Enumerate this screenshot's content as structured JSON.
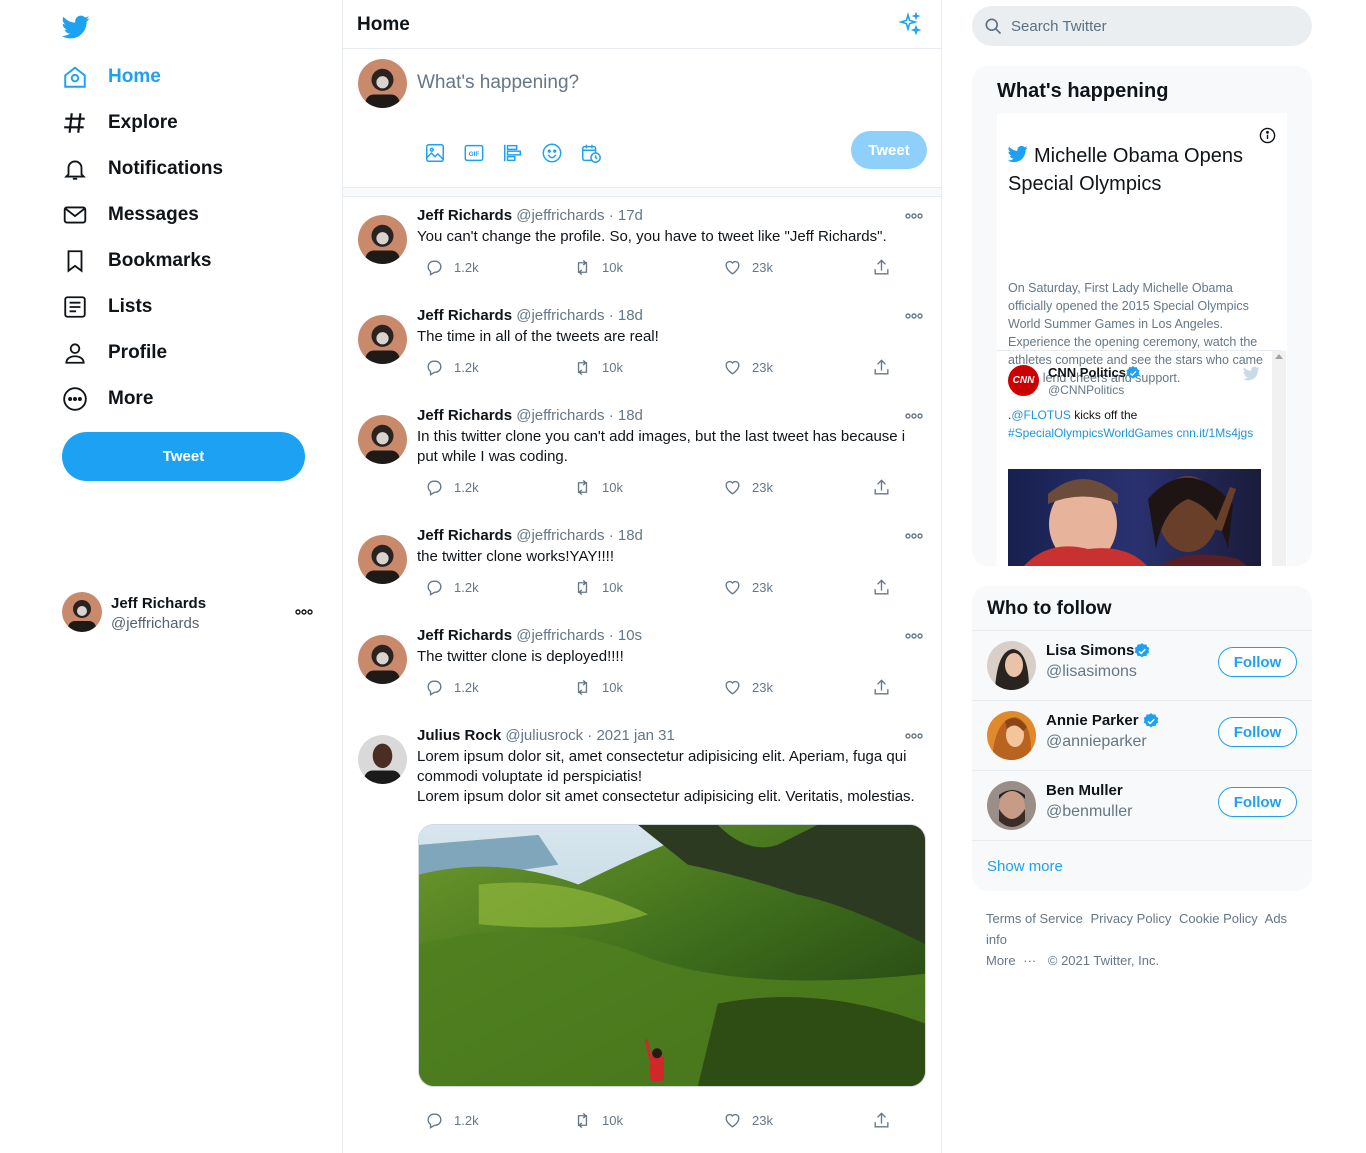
{
  "nav": {
    "items": [
      {
        "label": "Home",
        "icon": "home-icon",
        "active": true
      },
      {
        "label": "Explore",
        "icon": "hashtag-icon"
      },
      {
        "label": "Notifications",
        "icon": "bell-icon"
      },
      {
        "label": "Messages",
        "icon": "mail-icon"
      },
      {
        "label": "Bookmarks",
        "icon": "bookmark-icon"
      },
      {
        "label": "Lists",
        "icon": "list-icon"
      },
      {
        "label": "Profile",
        "icon": "profile-icon"
      },
      {
        "label": "More",
        "icon": "more-circle-icon"
      }
    ],
    "tweet_button": "Tweet"
  },
  "account": {
    "name": "Jeff Richards",
    "handle": "@jeffrichards"
  },
  "main": {
    "title": "Home",
    "composer": {
      "placeholder": "What's happening?",
      "tweet_button": "Tweet"
    }
  },
  "tweets": [
    {
      "name": "Jeff Richards",
      "handle": "@jeffrichards",
      "time": " · 17d",
      "text": "You can't change the profile. So, you have to tweet like \"Jeff Richards\".",
      "replies": "1.2k",
      "retweets": "10k",
      "likes": "23k"
    },
    {
      "name": "Jeff Richards",
      "handle": "@jeffrichards",
      "time": " · 18d",
      "text": "The time in all of the tweets are real!",
      "replies": "1.2k",
      "retweets": "10k",
      "likes": "23k"
    },
    {
      "name": "Jeff Richards",
      "handle": "@jeffrichards",
      "time": " · 18d",
      "text": "In this twitter clone you can't add images, but the last tweet has because i put while I was coding.",
      "replies": "1.2k",
      "retweets": "10k",
      "likes": "23k"
    },
    {
      "name": "Jeff Richards",
      "handle": "@jeffrichards",
      "time": " · 18d",
      "text": "the twitter clone works!YAY!!!!",
      "replies": "1.2k",
      "retweets": "10k",
      "likes": "23k"
    },
    {
      "name": "Jeff Richards",
      "handle": "@jeffrichards",
      "time": " · 10s",
      "text": "The twitter clone is deployed!!!!",
      "replies": "1.2k",
      "retweets": "10k",
      "likes": "23k"
    },
    {
      "name": "Julius Rock",
      "handle": "@juliusrock",
      "time": " · 2021 jan 31",
      "text": "Lorem ipsum dolor sit, amet consectetur adipisicing elit. Aperiam, fuga qui commodi voluptate id perspiciatis!",
      "text2": "Lorem ipsum dolor sit amet consectetur adipisicing elit. Veritatis, molestias.",
      "replies": "1.2k",
      "retweets": "10k",
      "likes": "23k"
    }
  ],
  "search": {
    "placeholder": "Search Twitter"
  },
  "whats_happening": {
    "title": "What's happening",
    "headline": "Michelle Obama Opens Special Olympics",
    "description": "On Saturday, First Lady Michelle Obama officially opened the 2015 Special Olympics World Summer Games in Los Angeles. Experience the opening ceremony, watch the athletes compete and see the stars who came out to lend cheers and support.",
    "embed": {
      "logo_text": "CNN",
      "name": "CNN Politics",
      "handle": "@CNNPolitics",
      "text_prefix": ".",
      "mention": "@FLOTUS",
      "text_mid": " kicks off the",
      "hashtag": "#SpecialOlympicsWorldGames",
      "link": " cnn.it/1Ms4jgs"
    }
  },
  "who_to_follow": {
    "title": "Who to follow",
    "users": [
      {
        "name": "Lisa Simons",
        "handle": "@lisasimons",
        "button": "Follow"
      },
      {
        "name": "Annie Parker",
        "handle": "@annieparker",
        "button": "Follow"
      },
      {
        "name": "Ben Muller",
        "handle": "@benmuller",
        "button": "Follow"
      }
    ],
    "show_more": "Show more"
  },
  "footer": {
    "links": [
      "Terms of Service",
      "Privacy Policy",
      "Cookie Policy",
      "Ads info"
    ],
    "more": "More",
    "dots": "···",
    "copyright": "© 2021 Twitter, Inc."
  },
  "colors": {
    "accent": "#1da1f2",
    "muted": "#657786",
    "border": "#e6ecf0",
    "panel": "#f7f9fa"
  }
}
